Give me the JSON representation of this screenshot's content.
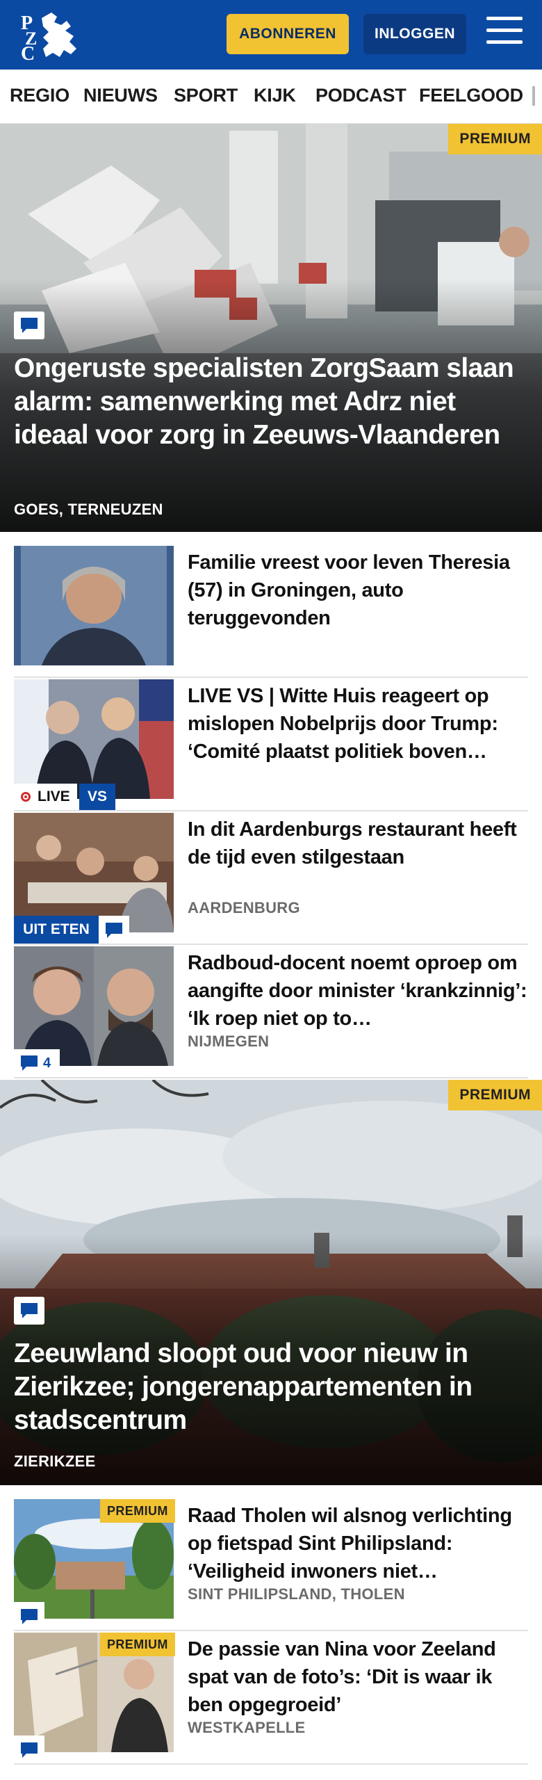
{
  "header": {
    "logo_text": "PZC",
    "subscribe_label": "ABONNEREN",
    "login_label": "INLOGGEN"
  },
  "nav": {
    "items": [
      "REGIO",
      "NIEUWS",
      "SPORT",
      "KIJK",
      "PODCAST",
      "FEELGOOD"
    ]
  },
  "hero1": {
    "badge": "PREMIUM",
    "title": "Ongeruste specialisten ZorgSaam slaan alarm: samenwerking met Adrz niet ideaal voor zorg in Zeeuws-Vlaanderen",
    "location": "GOES, TERNEUZEN"
  },
  "articles": [
    {
      "title": "Familie vreest voor leven Theresia (57) in Groningen, auto teruggevonden",
      "location": ""
    },
    {
      "title": "LIVE VS | Witte Huis reageert op mislopen Nobelprijs door Trump: ‘Comité plaatst politiek boven…",
      "live_label": "LIVE",
      "tag": "VS"
    },
    {
      "title": "In dit Aardenburgs restaurant heeft de tijd even stilgestaan",
      "location": "AARDENBURG",
      "tag": "UIT ETEN"
    },
    {
      "title": "Radboud-docent noemt oproep om aangifte door minister ‘krankzinnig’: ‘Ik roep niet op to…",
      "location": "NIJMEGEN",
      "comment_count": "4"
    }
  ],
  "hero2": {
    "badge": "PREMIUM",
    "title": "Zeeuwland sloopt oud voor nieuw in Zierikzee; jongerenappartementen in stadscentrum",
    "location": "ZIERIKZEE"
  },
  "articles2": [
    {
      "badge": "PREMIUM",
      "title": "Raad Tholen wil alsnog verlich­ting op fietspad Sint Philipsland: ‘Veiligheid inwoners niet…",
      "location": "SINT PHILIPSLAND, THOLEN"
    },
    {
      "badge": "PREMIUM",
      "title": "De passie van Nina voor Zeeland spat van de foto’s: ‘Dit is waar ik ben opgegroeid’",
      "location": "WESTKAPELLE"
    }
  ],
  "colors": {
    "brand_blue": "#0b4aa3",
    "accent_yellow": "#f1c232",
    "live_red": "#d12b2b"
  },
  "icons": [
    "lion-logo",
    "menu-icon",
    "comment-icon",
    "live-dot-icon"
  ]
}
